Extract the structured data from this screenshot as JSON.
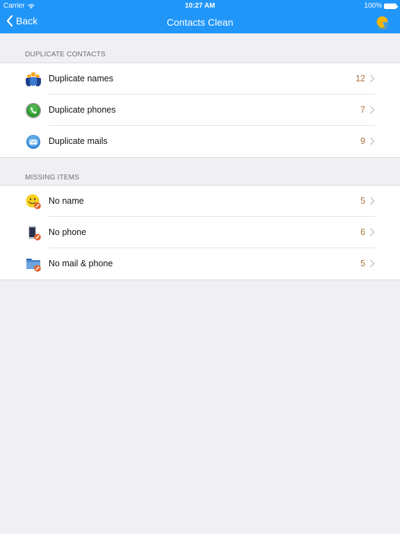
{
  "status_bar": {
    "carrier": "Carrier",
    "time": "10:27 AM",
    "battery": "100%"
  },
  "navbar": {
    "back_label": "Back",
    "title": "Contacts Clean",
    "right_icon": "pie-chart-icon",
    "background": "#2196f9"
  },
  "sections": [
    {
      "header": "DUPLICATE CONTACTS",
      "rows": [
        {
          "label": "Duplicate names",
          "count": "12",
          "icon": "group-people-icon"
        },
        {
          "label": "Duplicate phones",
          "count": "7",
          "icon": "phone-icon"
        },
        {
          "label": "Duplicate mails",
          "count": "9",
          "icon": "mail-icon"
        }
      ]
    },
    {
      "header": "MISSING ITEMS",
      "rows": [
        {
          "label": "No name",
          "count": "5",
          "icon": "smiley-missing-icon"
        },
        {
          "label": "No phone",
          "count": "6",
          "icon": "phone-device-missing-icon"
        },
        {
          "label": "No mail & phone",
          "count": "5",
          "icon": "folder-missing-icon"
        }
      ]
    }
  ],
  "colors": {
    "accent": "#2196f9",
    "count": "#a8703a",
    "background": "#efeff4"
  }
}
